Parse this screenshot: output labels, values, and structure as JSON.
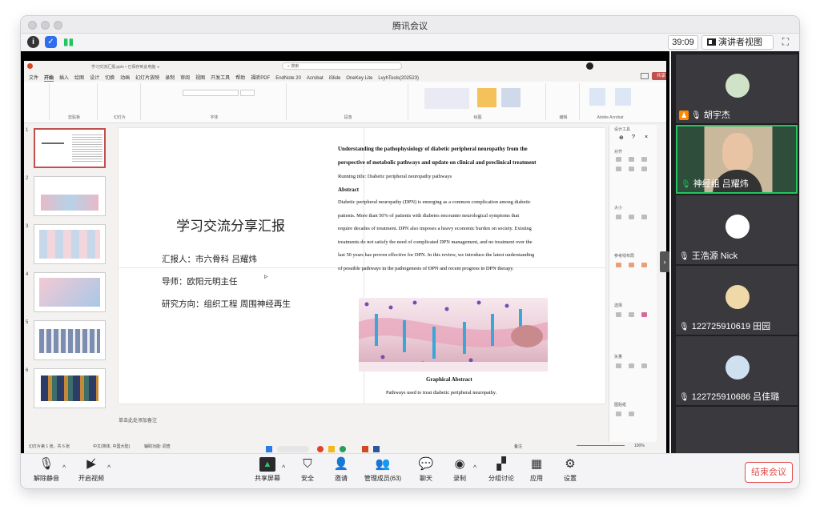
{
  "window": {
    "title": "腾讯会议"
  },
  "topbar": {
    "timer": "39:09",
    "view_label": "演讲者视图",
    "view_caret": "▾"
  },
  "ppt": {
    "filename": "学习交流汇报.pptx • 已保存到此电脑 ∨",
    "search_placeholder": "搜索",
    "tabs": [
      "文件",
      "开始",
      "插入",
      "绘图",
      "设计",
      "切换",
      "动画",
      "幻灯片放映",
      "录制",
      "审阅",
      "视图",
      "开发工具",
      "帮助",
      "福昕PDF",
      "EndNote 20",
      "Acrobat",
      "iSlide",
      "OneKey Lite",
      "LvyhTools(202523)"
    ],
    "share_label": "共享",
    "groups": [
      "剪贴板",
      "幻灯片",
      "字体",
      "段落",
      "绘图",
      "编辑",
      "Adobe Acrobat"
    ],
    "slide_numbers": [
      "1",
      "2",
      "3",
      "4",
      "5",
      "6"
    ],
    "design_panel": {
      "title": "设计工具",
      "sections": [
        "对齐",
        "大小",
        "参考线布局",
        "选择",
        "矢量",
        "图贴纸"
      ]
    },
    "notes_placeholder": "单击此处添加备注",
    "status": {
      "left": "幻灯片第 1 张，共 6 张",
      "lang": "中文(简体, 中国大陆)",
      "accessibility": "辅助功能: 调查",
      "notes_btn": "备注",
      "zoom": "100%"
    }
  },
  "slide": {
    "title": "学习交流分享汇报",
    "reporter": "汇报人：市六骨科 吕耀炜",
    "advisor": "导师：欧阳元明主任",
    "direction": "研究方向：组织工程 周围神经再生",
    "paper_title_1": "Understanding the pathophysiology of diabetic peripheral neuropathy from the",
    "paper_title_2": "perspective of metabolic pathways and update on clinical and preclinical treatment",
    "running_title": "Running title: Diabetic peripheral neuropathy pathways",
    "abstract_heading": "Abstract",
    "abstract_lines": [
      "Diabetic peripheral neuropathy (DPN) is emerging as a common complication among diabetic",
      "patients. More than 50% of patients with diabetes encounter neurological symptoms that",
      "require decades of treatment. DPN also imposes a heavy economic burden on society. Existing",
      "treatments do not satisfy the need of complicated DPN management, and no treatment over the",
      "last 50 years has proven effective for DPN. In this review, we introduce the latest understanding",
      "of possible pathways in the pathogenesis of DPN and recent progress in DPN therapy."
    ],
    "ga_title": "Graphical Abstract",
    "ga_text": "Pathways used to treat diabetic peripheral neuropathy."
  },
  "participants": [
    {
      "name": "胡宇杰",
      "host": true,
      "active": false
    },
    {
      "name": "神经组 吕耀炜",
      "host": false,
      "active": true
    },
    {
      "name": "王浩源 Nick",
      "host": false,
      "active": false
    },
    {
      "name": "122725910619 田园",
      "host": false,
      "active": false
    },
    {
      "name": "122725910686 吕佳璐",
      "host": false,
      "active": false
    }
  ],
  "toolbar": {
    "unmute": "解除静音",
    "start_video": "开启视频",
    "share_screen": "共享屏幕",
    "security": "安全",
    "invite": "邀请",
    "manage": "管理成员(63)",
    "chat": "聊天",
    "record": "录制",
    "breakout": "分组讨论",
    "apps": "应用",
    "settings": "设置",
    "end": "结束会议"
  },
  "colors": {
    "accent_green": "#22c55e",
    "end_red": "#e34d4d",
    "ppt_red": "#c0504d",
    "host_orange": "#ff8a00"
  }
}
